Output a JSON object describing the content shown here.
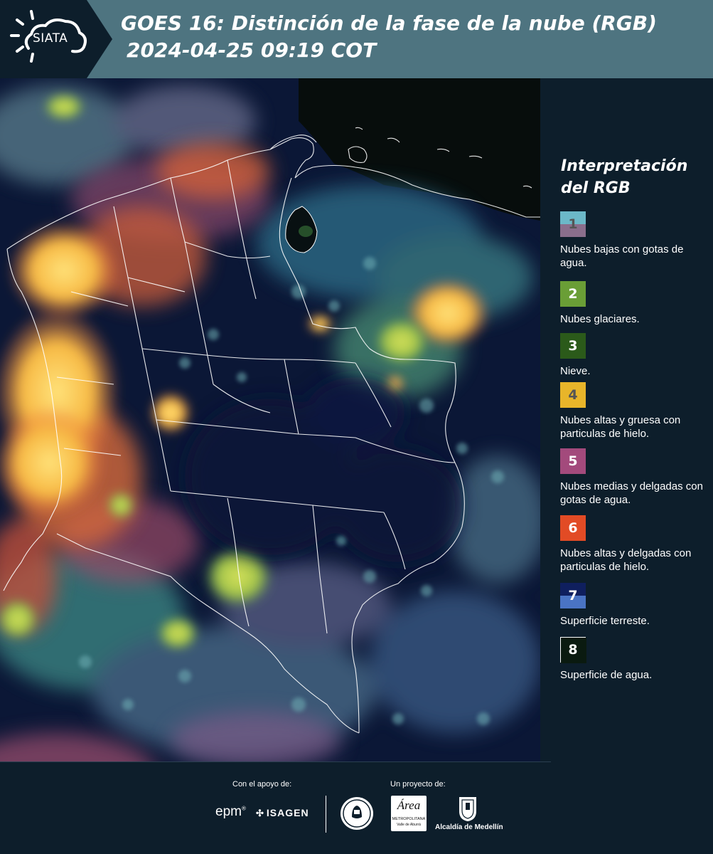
{
  "header": {
    "logo_text": "SIATA",
    "title_line1": "GOES 16: Distinción de la fase de la nube (RGB)",
    "title_line2": "2024-04-25 09:19 COT",
    "background_color": "#4e7480"
  },
  "legend": {
    "title_line1": "Interpretación",
    "title_line2": "del RGB",
    "items": [
      {
        "number": "1",
        "label": "Nubes bajas con gotas de agua.",
        "color_top": "#6cb8c8",
        "color_bottom": "#8a6e8c",
        "text_color": "#555555"
      },
      {
        "number": "2",
        "label": "Nubes glaciares.",
        "color_top": "#6a9e36",
        "color_bottom": "#6a9e36",
        "text_color": "#ffffff"
      },
      {
        "number": "3",
        "label": "Nieve.",
        "color_top": "#2b5a1a",
        "color_bottom": "#2b5a1a",
        "text_color": "#ffffff"
      },
      {
        "number": "4",
        "label": "Nubes altas y gruesa con particulas de hielo.",
        "color_top": "#e8b52a",
        "color_bottom": "#e8b52a",
        "text_color": "#555555"
      },
      {
        "number": "5",
        "label": "Nubes medias y delgadas con gotas de agua.",
        "color_top": "#a34a7c",
        "color_bottom": "#a34a7c",
        "text_color": "#ffffff"
      },
      {
        "number": "6",
        "label": "Nubes altas y delgadas con particulas de hielo.",
        "color_top": "#e24b25",
        "color_bottom": "#e24b25",
        "text_color": "#ffffff"
      },
      {
        "number": "7",
        "label": "Superficie terreste.",
        "color_top": "#0f1f5e",
        "color_bottom": "#4a74c4",
        "text_color": "#ffffff"
      },
      {
        "number": "8",
        "label": "Superficie de agua.",
        "color_top": "#0a1a10",
        "color_bottom": "#0a1a10",
        "text_color": "#ffffff"
      }
    ]
  },
  "footer": {
    "support_label": "Con el apoyo de:",
    "project_label": "Un proyecto de:",
    "epm": "epm",
    "isagen": "ISAGEN",
    "amva_line1": "Área",
    "amva_line2": "METROPOLITANA",
    "amva_line3": "Valle de Aburrá",
    "alcaldia": "Alcaldía de Medellín"
  }
}
